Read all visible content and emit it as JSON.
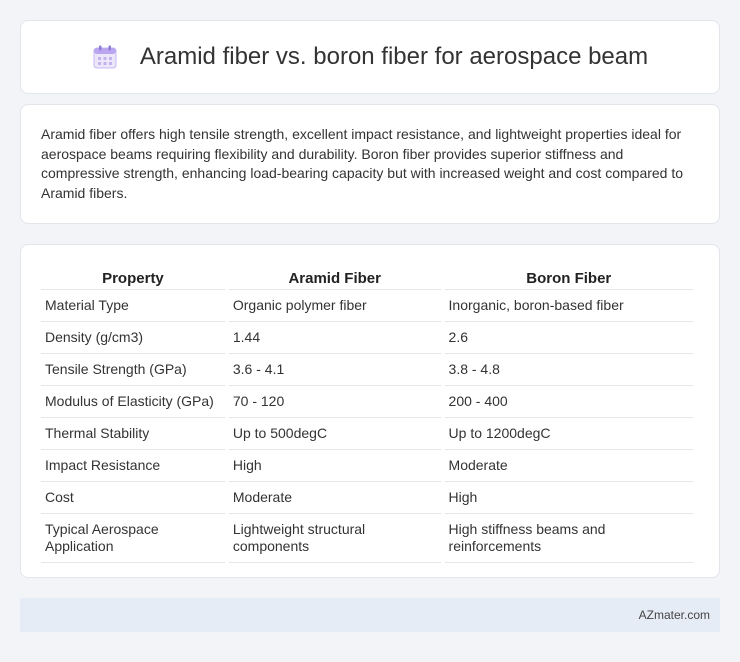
{
  "header": {
    "title": "Aramid fiber vs. boron fiber for aerospace beam",
    "icon": "calendar-icon"
  },
  "intro": {
    "text": "Aramid fiber offers high tensile strength, excellent impact resistance, and lightweight properties ideal for aerospace beams requiring flexibility and durability. Boron fiber provides superior stiffness and compressive strength, enhancing load-bearing capacity but with increased weight and cost compared to Aramid fibers."
  },
  "table": {
    "headers": [
      "Property",
      "Aramid Fiber",
      "Boron Fiber"
    ],
    "rows": [
      [
        "Material Type",
        "Organic polymer fiber",
        "Inorganic, boron-based fiber"
      ],
      [
        "Density (g/cm3)",
        "1.44",
        "2.6"
      ],
      [
        "Tensile Strength (GPa)",
        "3.6 - 4.1",
        "3.8 - 4.8"
      ],
      [
        "Modulus of Elasticity (GPa)",
        "70 - 120",
        "200 - 400"
      ],
      [
        "Thermal Stability",
        "Up to 500degC",
        "Up to 1200degC"
      ],
      [
        "Impact Resistance",
        "High",
        "Moderate"
      ],
      [
        "Cost",
        "Moderate",
        "High"
      ],
      [
        "Typical Aerospace Application",
        "Lightweight structural components",
        "High stiffness beams and reinforcements"
      ]
    ]
  },
  "footer": {
    "source": "AZmater.com"
  },
  "colors": {
    "background": "#f3f4f7",
    "footer_bg": "#e6ecf6"
  }
}
